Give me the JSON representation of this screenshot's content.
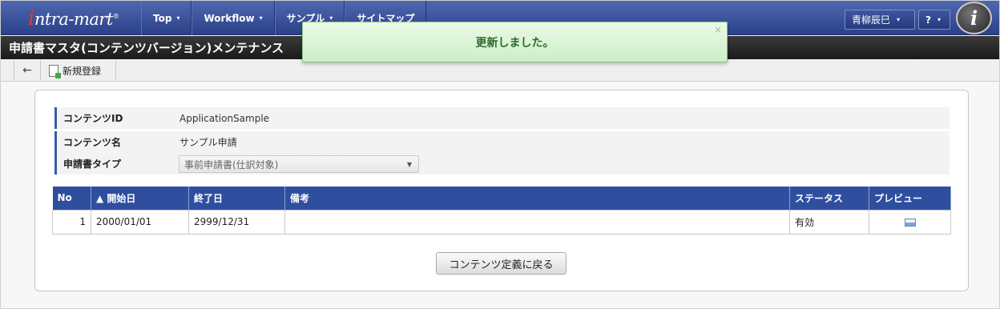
{
  "header": {
    "logo": {
      "first": "i",
      "rest": "ntra-mart",
      "mark": "®"
    },
    "nav": [
      {
        "label": "Top",
        "caret": "▾"
      },
      {
        "label": "Workflow",
        "caret": "▾"
      },
      {
        "label": "サンプル",
        "caret": "▾"
      },
      {
        "label": "サイトマップ",
        "caret": ""
      }
    ],
    "user_name": "青柳辰巳",
    "help_label": "?",
    "badge_text": "i"
  },
  "page": {
    "title": "申請書マスタ(コンテンツバージョン)メンテナンス"
  },
  "toolbar": {
    "back_icon": "←",
    "new_label": "新規登録"
  },
  "toast": {
    "message": "更新しました。",
    "close": "×"
  },
  "form": {
    "content_id": {
      "label": "コンテンツID",
      "value": "ApplicationSample"
    },
    "content_name": {
      "label": "コンテンツ名",
      "value": "サンプル申請"
    },
    "form_type": {
      "label": "申請書タイプ",
      "value": "事前申請書(仕訳対象)"
    }
  },
  "table": {
    "headers": [
      "No",
      "▲ 開始日",
      "終了日",
      "備考",
      "ステータス",
      "プレビュー"
    ],
    "rows": [
      {
        "no": "1",
        "start": "2000/01/01",
        "end": "2999/12/31",
        "note": "",
        "status": "有効"
      }
    ]
  },
  "footer": {
    "back_button": "コンテンツ定義に戻る"
  },
  "colors": {
    "nav": "#2f4e9e",
    "title_bar": "#222222",
    "toast_text": "#2d6a2d"
  }
}
